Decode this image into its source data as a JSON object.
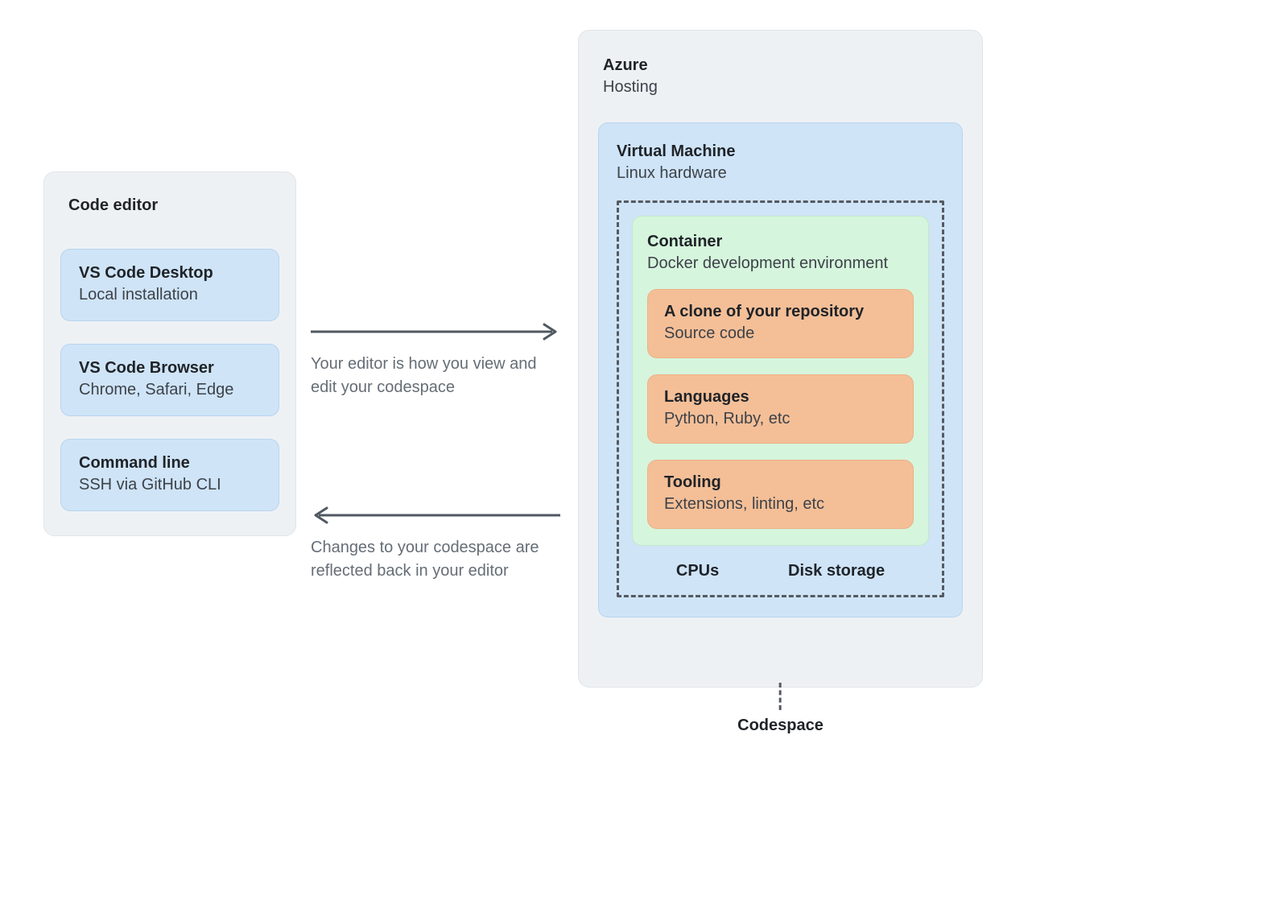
{
  "editor": {
    "title": "Code editor",
    "cards": [
      {
        "title": "VS Code Desktop",
        "subtitle": "Local installation"
      },
      {
        "title": "VS Code Browser",
        "subtitle": "Chrome, Safari, Edge"
      },
      {
        "title": "Command line",
        "subtitle": "SSH via GitHub CLI"
      }
    ]
  },
  "arrows": {
    "to_codespace": "Your editor is how you view and edit your codespace",
    "from_codespace": "Changes to your codespace are reflected back in your editor"
  },
  "azure": {
    "title": "Azure",
    "subtitle": "Hosting",
    "vm": {
      "title": "Virtual Machine",
      "subtitle": "Linux hardware",
      "container": {
        "title": "Container",
        "subtitle": "Docker development environment",
        "items": [
          {
            "title": "A clone of your repository",
            "subtitle": "Source code"
          },
          {
            "title": "Languages",
            "subtitle": "Python, Ruby, etc"
          },
          {
            "title": "Tooling",
            "subtitle": "Extensions, linting, etc"
          }
        ]
      },
      "resources": {
        "cpus": "CPUs",
        "disk": "Disk storage"
      }
    },
    "codespace_label": "Codespace"
  },
  "colors": {
    "panel_bg": "#eef1f4",
    "blue_card": "#cfe4f7",
    "green_card": "#d6f5dd",
    "orange_card": "#f4bf97",
    "arrow": "#505860",
    "muted_text": "#656d76"
  }
}
